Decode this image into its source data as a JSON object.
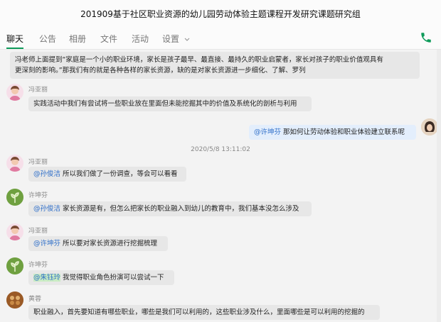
{
  "window": {
    "title": "201909基于社区职业资源的幼儿园劳动体验主题课程开发研究课题研究组"
  },
  "tabs": [
    {
      "label": "聊天"
    },
    {
      "label": "公告"
    },
    {
      "label": "相册"
    },
    {
      "label": "文件"
    },
    {
      "label": "活动"
    },
    {
      "label": "设置"
    }
  ],
  "header_icons": {
    "phone": "phone-icon",
    "settings_arrow": "chevron-down-icon"
  },
  "colors": {
    "accent": "#0e9b5a",
    "mention": "#2f6fc9",
    "bubble": "#e7e7e7",
    "bubble_me": "#e3eefc"
  },
  "messages": [
    {
      "line1": "冯老师上面提到“家庭是一个小的职业环境，家长是孩子最早、最直接、最持久的职业启蒙者，家长对孩子的职业价值观具有",
      "line2": "更深刻的影响。”那我们有的就是各种各样的家长资源，缺的是对家长资源进一步细化、了解、罗列"
    },
    {
      "sender": "冯亚丽",
      "text": "实践活动中我们有尝试将一些职业放在里面但未能挖掘其中的价值及系统化的剖析与利用"
    },
    {
      "mention": "@许坤芬",
      "text": " 那如何让劳动体验和职业体验建立联系呢"
    },
    {
      "timestamp": "2020/5/8 13:11:02"
    },
    {
      "sender": "冯亚丽",
      "mention": "@孙俊洁",
      "text": " 所以我们做了一份调查，等会可以看看"
    },
    {
      "sender": "许坤芬",
      "mention": "@孙俊洁",
      "text": " 家长资源是有，但怎么把家长的职业融入到幼儿的教育中，我们基本没怎么涉及"
    },
    {
      "sender": "冯亚丽",
      "mention": "@许坤芬",
      "text": " 所以要对家长资源进行挖掘梳理"
    },
    {
      "sender": "许坤芬",
      "mention": "@朱钰玲",
      "text": " 我觉得职业角色扮演可以尝试一下"
    },
    {
      "sender": "黄蓉",
      "text": "职业融入，首先要知道有哪些职业，哪些是我们可以利用的，这些职业涉及什么，里面哪些是可以利用的挖掘的"
    }
  ]
}
